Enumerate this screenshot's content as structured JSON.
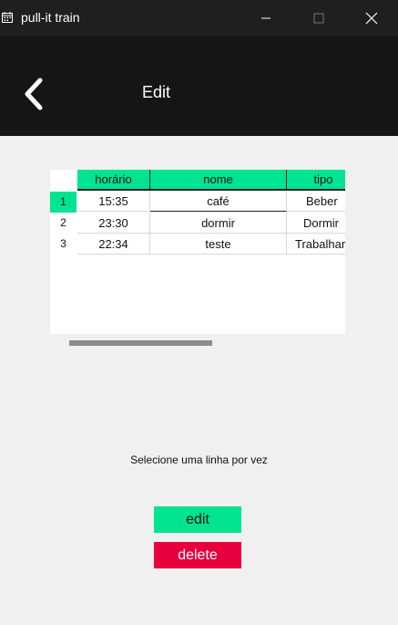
{
  "window": {
    "title": "pull-it train",
    "icons": {
      "app": "calendar-icon",
      "minimize": "minimize-icon",
      "maximize": "maximize-icon",
      "close": "close-icon"
    }
  },
  "header": {
    "title": "Edit",
    "back_icon": "chevron-left-icon"
  },
  "table": {
    "columns": [
      "horário",
      "nome",
      "tipo"
    ],
    "rows": [
      {
        "index": "1",
        "horario": "15:35",
        "nome": "café",
        "tipo": "Beber",
        "selected": true
      },
      {
        "index": "2",
        "horario": "23:30",
        "nome": "dormir",
        "tipo": "Dormir",
        "selected": false
      },
      {
        "index": "3",
        "horario": "22:34",
        "nome": "teste",
        "tipo": "Trabalhar",
        "selected": false
      }
    ]
  },
  "hint": "Selecione uma linha por vez",
  "buttons": {
    "edit": "edit",
    "delete": "delete"
  },
  "colors": {
    "accent": "#00e391",
    "danger": "#e8003d",
    "header_bg": "#151515"
  }
}
